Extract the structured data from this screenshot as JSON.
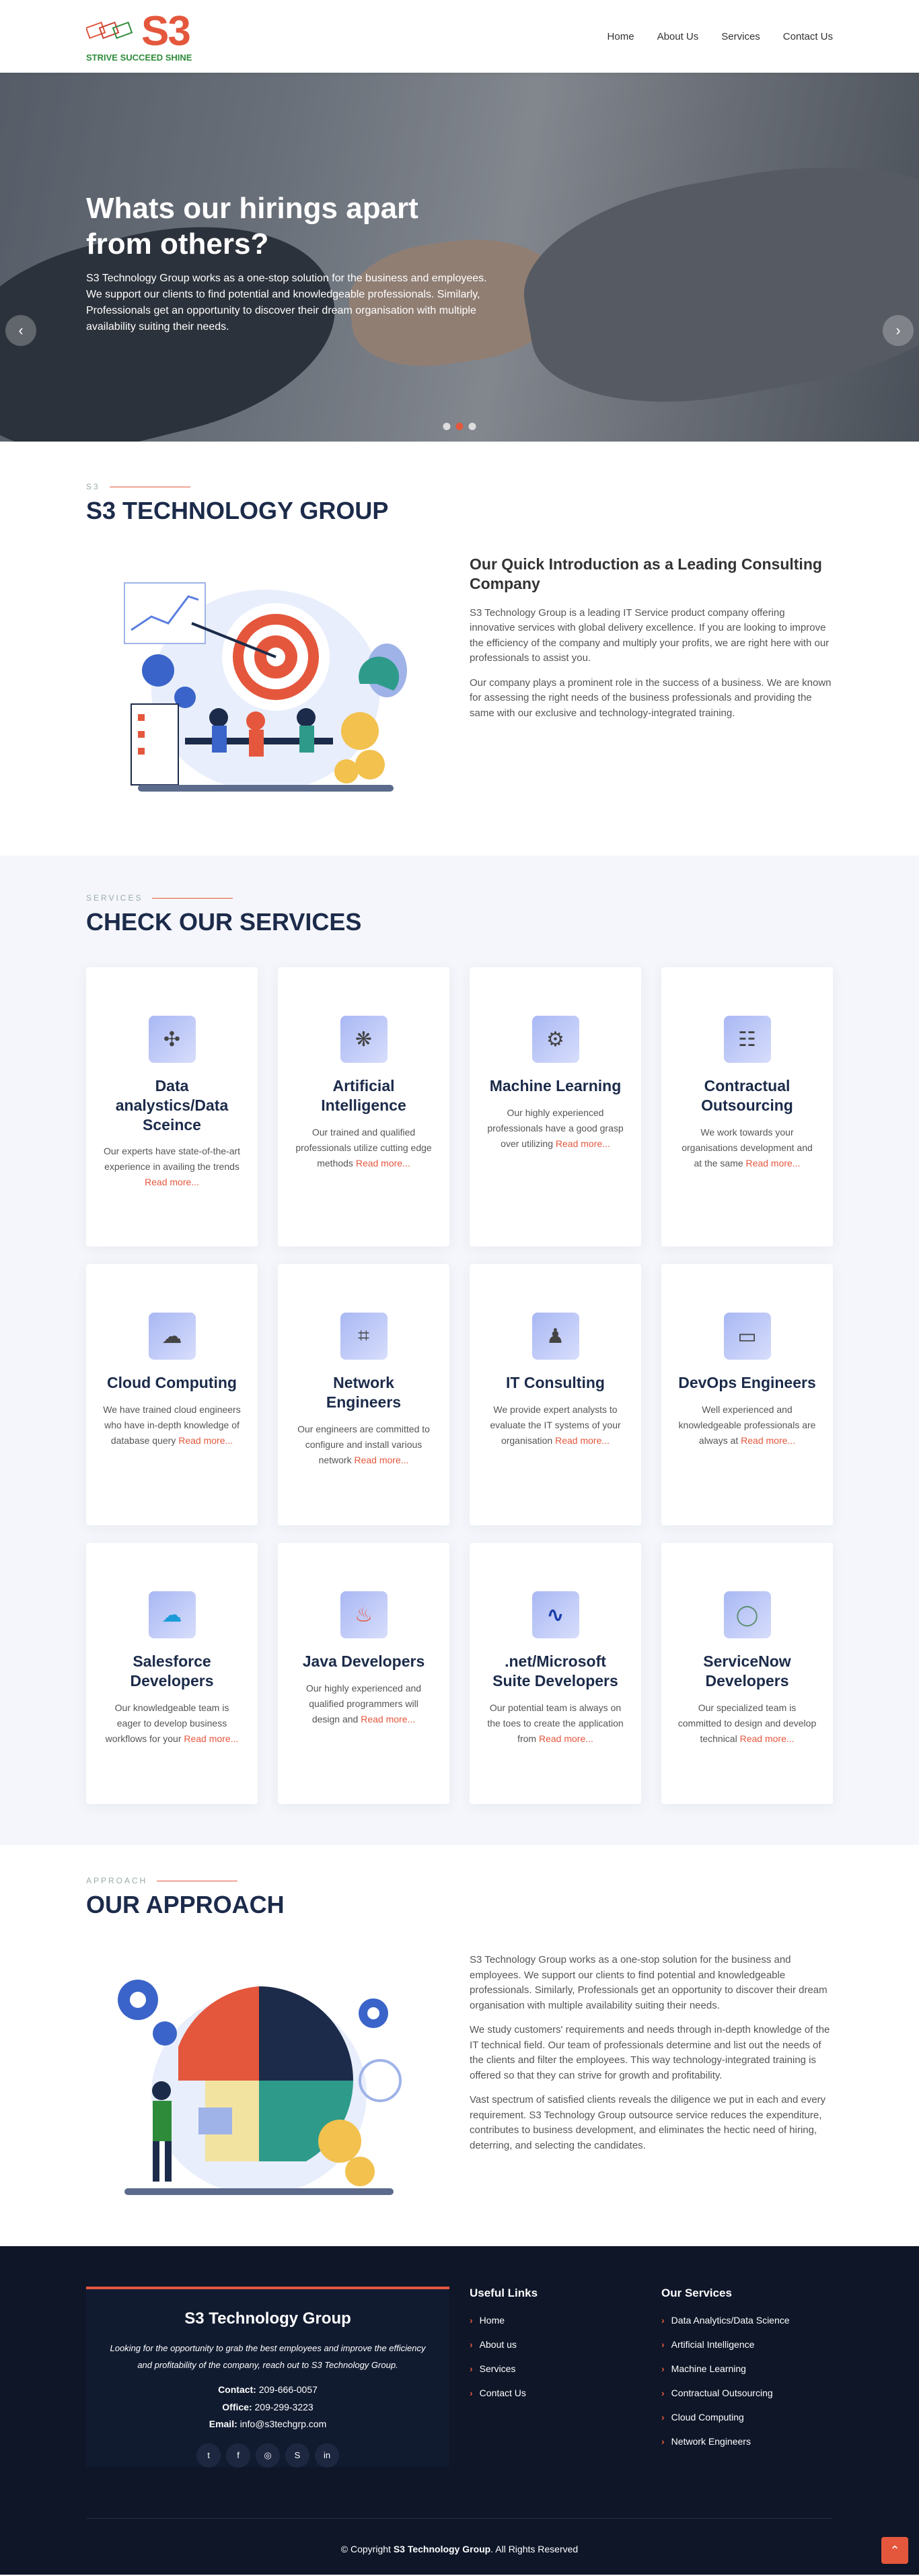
{
  "header": {
    "logo_text": "S3",
    "logo_tagline": "STRIVE SUCCEED SHINE",
    "nav": [
      "Home",
      "About Us",
      "Services",
      "Contact Us"
    ]
  },
  "hero": {
    "title": "Whats our hirings apart from others?",
    "text": "S3 Technology Group works as a one-stop solution for the business and employees. We support our clients to find potential and knowledgeable professionals. Similarly, Professionals get an opportunity to discover their dream organisation with multiple availability suiting their needs."
  },
  "about": {
    "label": "S3",
    "title": "S3 TECHNOLOGY GROUP",
    "subtitle": "Our Quick Introduction as a Leading Consulting Company",
    "p1": "S3 Technology Group is a leading IT Service product company offering innovative services with global delivery excellence. If you are looking to improve the efficiency of the company and multiply your profits, we are right here with our professionals to assist you.",
    "p2": "Our company plays a prominent role in the success of a business. We are known for assessing the right needs of the business professionals and providing the same with our exclusive and technology-integrated training."
  },
  "services": {
    "label": "SERVICES",
    "title": "CHECK OUR SERVICES",
    "read_more": "Read more...",
    "items": [
      {
        "title": "Data analystics/Data Sceince",
        "desc": "Our experts have state-of-the-art experience in availing the trends",
        "icon": "data-network-icon"
      },
      {
        "title": "Artificial Intelligence",
        "desc": "Our trained and qualified professionals utilize cutting edge methods",
        "icon": "brain-circuit-icon"
      },
      {
        "title": "Machine Learning",
        "desc": "Our highly experienced professionals have a good grasp over utilizing",
        "icon": "gear-brain-icon"
      },
      {
        "title": "Contractual Outsourcing",
        "desc": "We work towards your organisations development and at the same",
        "icon": "team-icon"
      },
      {
        "title": "Cloud Computing",
        "desc": "We have trained cloud engineers who have in-depth knowledge of database query",
        "icon": "cloud-network-icon"
      },
      {
        "title": "Network Engineers",
        "desc": "Our engineers are committed to configure and install various network",
        "icon": "network-chip-icon"
      },
      {
        "title": "IT Consulting",
        "desc": "We provide expert analysts to evaluate the IT systems of your organisation",
        "icon": "consultant-icon"
      },
      {
        "title": "DevOps Engineers",
        "desc": "Well experienced and knowledgeable professionals are always at",
        "icon": "monitor-icon"
      },
      {
        "title": "Salesforce Developers",
        "desc": "Our knowledgeable team is eager to develop business workflows for your",
        "icon": "salesforce-cloud-icon"
      },
      {
        "title": "Java Developers",
        "desc": "Our highly experienced and qualified programmers will design and",
        "icon": "java-icon"
      },
      {
        "title": ".net/Microsoft Suite Developers",
        "desc": "Our potential team is always on the toes to create the application from",
        "icon": "dotnet-icon"
      },
      {
        "title": "ServiceNow Developers",
        "desc": "Our specialized team is committed to design and develop technical",
        "icon": "servicenow-icon"
      }
    ]
  },
  "approach": {
    "label": "APPROACH",
    "title": "OUR APPROACH",
    "p1": "S3 Technology Group works as a one-stop solution for the business and employees. We support our clients to find potential and knowledgeable professionals. Similarly, Professionals get an opportunity to discover their dream organisation with multiple availability suiting their needs.",
    "p2": "We study customers' requirements and needs through in-depth knowledge of the IT technical field. Our team of professionals determine and list out the needs of the clients and filter the employees. This way technology-integrated training is offered so that they can strive for growth and profitability.",
    "p3": "Vast spectrum of satisfied clients reveals the diligence we put in each and every requirement. S3 Technology Group outsource service reduces the expenditure, contributes to business development, and eliminates the hectic need of hiring, deterring, and selecting the candidates."
  },
  "footer": {
    "company": "S3 Technology Group",
    "quote": "Looking for the opportunity to grab the best employees and improve the efficiency and profitability of the company, reach out to S3 Technology Group.",
    "contact_label": "Contact:",
    "contact": "209-666-0057",
    "office_label": "Office:",
    "office": "209-299-3223",
    "email_label": "Email:",
    "email": "info@s3techgrp.com",
    "social": [
      "twitter-icon",
      "facebook-icon",
      "instagram-icon",
      "skype-icon",
      "linkedin-icon"
    ],
    "useful_title": "Useful Links",
    "useful": [
      "Home",
      "About us",
      "Services",
      "Contact Us"
    ],
    "services_title": "Our Services",
    "services": [
      "Data Analytics/Data Science",
      "Artificial Intelligence",
      "Machine Learning",
      "Contractual Outsourcing",
      "Cloud Computing",
      "Network Engineers"
    ],
    "copy_pre": "© Copyright",
    "copy_brand": "S3 Technology Group",
    "copy_post": ". All Rights Reserved"
  }
}
